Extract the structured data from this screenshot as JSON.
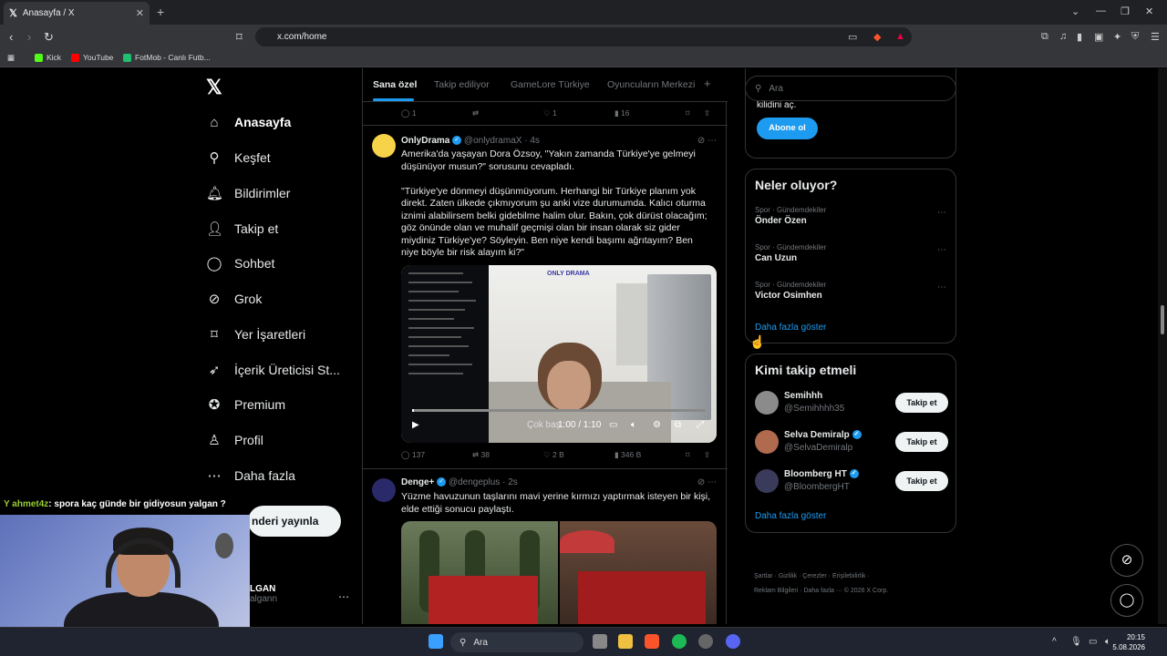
{
  "browser": {
    "tab_title": "Anasayfa / X",
    "url": "x.com/home",
    "bookmarks": [
      "Kick",
      "YouTube",
      "FotMob - Canlı Futb..."
    ]
  },
  "left_nav": {
    "items": [
      {
        "label": "Anasayfa",
        "icon": "home-icon"
      },
      {
        "label": "Keşfet",
        "icon": "search-icon"
      },
      {
        "label": "Bildirimler",
        "icon": "bell-icon"
      },
      {
        "label": "Takip et",
        "icon": "person-plus-icon"
      },
      {
        "label": "Sohbet",
        "icon": "chat-icon"
      },
      {
        "label": "Grok",
        "icon": "grok-icon"
      },
      {
        "label": "Yer İşaretleri",
        "icon": "bookmark-icon"
      },
      {
        "label": "İçerik Üreticisi St...",
        "icon": "rocket-icon"
      },
      {
        "label": "Premium",
        "icon": "premium-icon"
      },
      {
        "label": "Profil",
        "icon": "person-icon"
      },
      {
        "label": "Daha fazla",
        "icon": "more-circle-icon"
      }
    ],
    "post_button": "nderi yayınla",
    "account_name": "LGAN",
    "account_handle": "algann"
  },
  "feed_tabs": [
    "Sana özel",
    "Takip ediliyor",
    "GameLore Türkiye",
    "Oyuncuların Merkezi"
  ],
  "top_actions": {
    "replies": "1",
    "reposts": "",
    "likes": "1",
    "views": "16"
  },
  "tweets": [
    {
      "name": "OnlyDrama",
      "handle": "@onlydramaX",
      "time": "4s",
      "text": "Amerika'da yaşayan Dora Özsoy, \"Yakın zamanda Türkiye'ye gelmeyi düşünüyor musun?\" sorusunu cevapladı.\n\n\"Türkiye'ye dönmeyi düşünmüyorum. Herhangi bir Türkiye planım yok direkt. Zaten ülkede çıkmıyorum şu anki vize durumumda. Kalıcı oturma iznimi alabilirsem belki gidebilme halim olur. Bakın, çok dürüst olacağım; göz önünde olan ve muhalif geçmişi olan bir insan olarak siz gider miydiniz Türkiye'ye? Söyleyin. Ben niye kendi başımı ağrıtayım? Ben niye böyle bir risk alayım ki?\"",
      "video_brand": "ONLY DRAMA",
      "video_time": "1:00 / 1:10",
      "video_caption": "Çok baş",
      "video_progress": 0.005,
      "replies": "137",
      "reposts": "38",
      "likes": "2 B",
      "views": "346 B"
    },
    {
      "name": "Denge+",
      "handle": "@dengeplus",
      "time": "2s",
      "text": "Yüzme havuzunun taşlarını mavi yerine kırmızı yaptırmak isteyen bir kişi, elde ettiği sonucu paylaştı."
    }
  ],
  "right": {
    "search_placeholder": "Ara",
    "premium_text": "kilidini aç.",
    "subscribe_button": "Abone ol",
    "trends_title": "Neler oluyor?",
    "trends": [
      {
        "category": "Spor · Gündemdekiler",
        "name": "Önder Özen"
      },
      {
        "category": "Spor · Gündemdekiler",
        "name": "Can Uzun"
      },
      {
        "category": "Spor · Gündemdekiler",
        "name": "Victor Osimhen"
      }
    ],
    "show_more": "Daha fazla göster",
    "follow_title": "Kimi takip etmeli",
    "follow": [
      {
        "name": "Semihhh",
        "handle": "@Semihhhh35",
        "verified": false
      },
      {
        "name": "Selva Demiralp",
        "handle": "@SelvaDemiralp",
        "verified": true
      },
      {
        "name": "Bloomberg HT",
        "handle": "@BloombergHT",
        "verified": true
      }
    ],
    "follow_button": "Takip et",
    "footer_line1": "Şartlar · Gizlilik · Çerezler · Erişilebilirlik ·",
    "footer_line2": "Reklam Bilgileri · Daha fazla ··· © 2026 X Corp."
  },
  "stream": {
    "chat_user": "ahmet4z",
    "chat_message": ": spora kaç günde bir gidiyosun yalgan ?"
  },
  "taskbar": {
    "search": "Ara",
    "time": "20:15",
    "date": "5.08.2026"
  },
  "colors": {
    "accent": "#1d9bf0",
    "background": "#000000",
    "border": "#2f3336"
  }
}
